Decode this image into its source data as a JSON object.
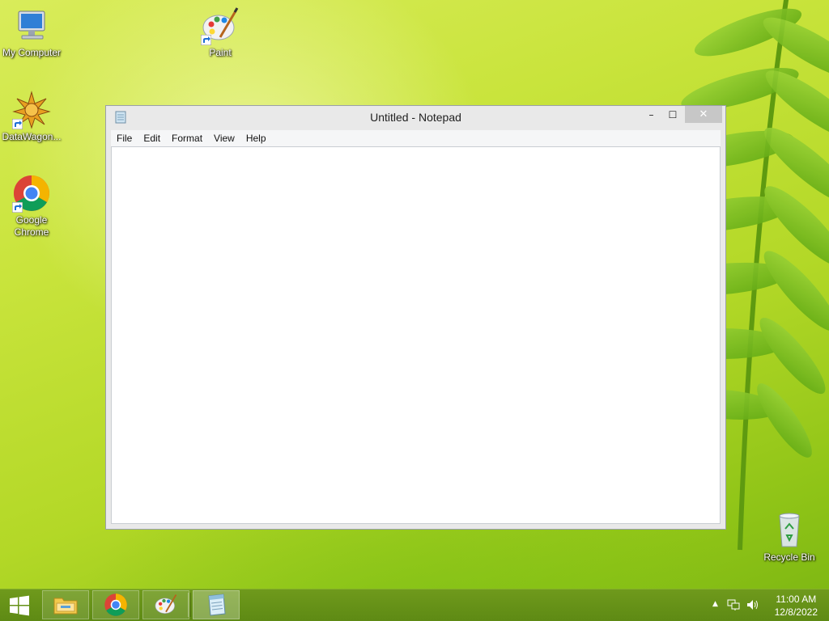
{
  "desktop": {
    "icons": [
      {
        "label": "My Computer",
        "icon": "computer-icon"
      },
      {
        "label": "Paint",
        "icon": "paint-palette-icon"
      },
      {
        "label": "DataWagon...",
        "icon": "datawagon-icon"
      },
      {
        "label": "Google Chrome",
        "icon": "chrome-icon"
      },
      {
        "label": "Recycle Bin",
        "icon": "recycle-bin-icon"
      }
    ]
  },
  "notepad": {
    "title": "Untitled - Notepad",
    "menu": [
      "File",
      "Edit",
      "Format",
      "View",
      "Help"
    ],
    "content": "",
    "controls": {
      "minimize": "–",
      "maximize": "☐",
      "close": "✕"
    }
  },
  "taskbar": {
    "pinned": [
      {
        "name": "File Explorer",
        "icon": "file-explorer-icon"
      },
      {
        "name": "Google Chrome",
        "icon": "chrome-icon"
      },
      {
        "name": "Paint",
        "icon": "paint-palette-icon"
      },
      {
        "name": "Notepad",
        "icon": "notepad-icon",
        "active": true
      }
    ],
    "tray": {
      "icons": [
        "show-hidden-icons-chevron-icon",
        "network-icon",
        "volume-icon"
      ],
      "time": "11:00 AM",
      "date": "12/8/2022"
    }
  },
  "colors": {
    "wallpaper": "#c9e43c",
    "taskbar": "#6a9519",
    "close_button": "#c7c7c7",
    "window_frame": "#e9e9e9"
  }
}
